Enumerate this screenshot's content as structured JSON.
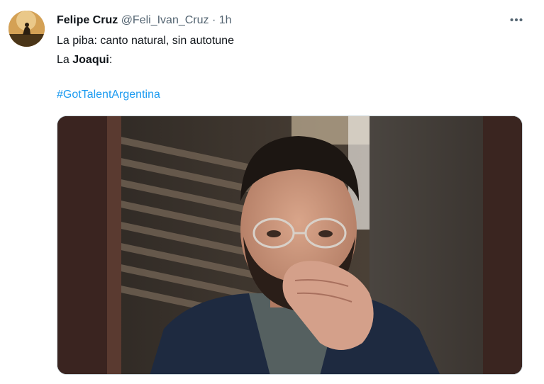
{
  "tweet": {
    "author_name": "Felipe Cruz",
    "handle": "@Feli_Ivan_Cruz",
    "separator": "·",
    "time": "1h",
    "more_icon": "more-horizontal-icon",
    "line1": "La piba: canto natural, sin autotune",
    "line2_prefix": "La ",
    "line2_bold": "Joaqui",
    "line2_suffix": ":",
    "hashtag": "#GotTalentArgentina",
    "media_description_icon": "photo-media",
    "colors": {
      "text": "#0f1419",
      "secondary": "#536471",
      "link": "#1d9bf0",
      "border": "#cfd9de"
    }
  }
}
